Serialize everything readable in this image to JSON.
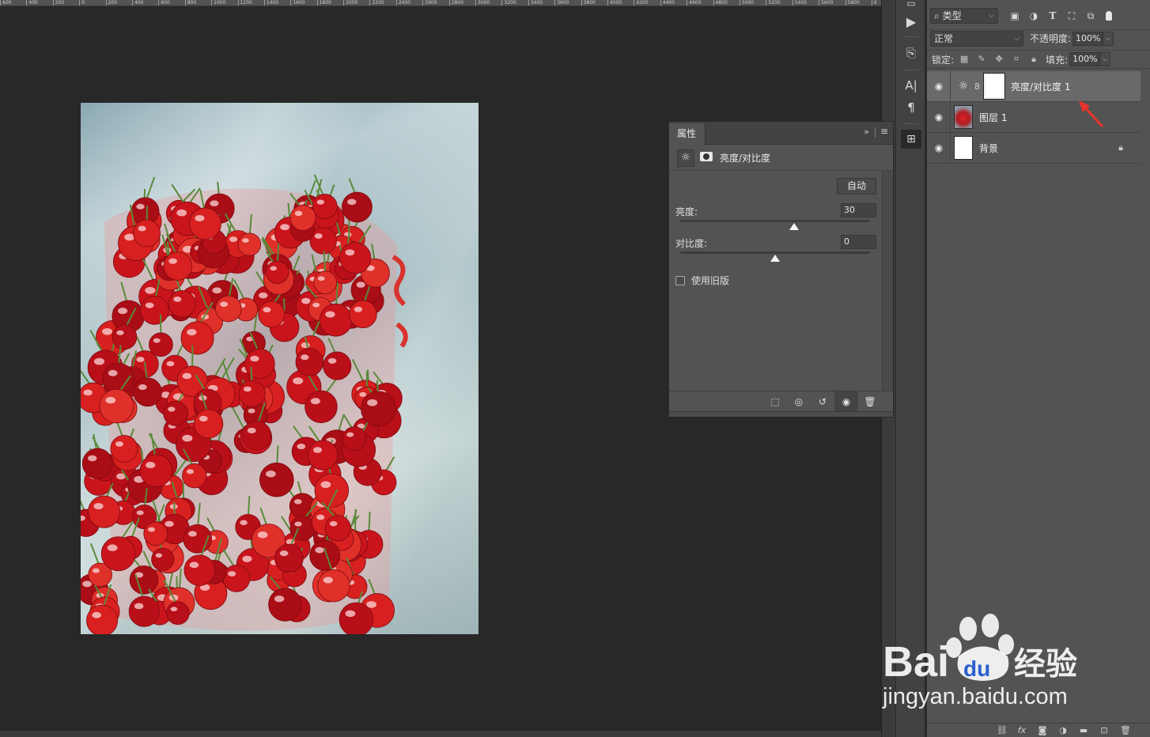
{
  "ruler": {
    "ticks": [
      "600",
      "400",
      "200",
      "0",
      "200",
      "400",
      "600",
      "800",
      "1000",
      "1200",
      "1400",
      "1600",
      "1800",
      "2000",
      "2200",
      "2400",
      "2600",
      "2800",
      "3000",
      "3200",
      "3400",
      "3600",
      "3800",
      "4000",
      "4200",
      "4400",
      "4600",
      "4800",
      "5000",
      "5200",
      "5400",
      "5600",
      "5800",
      "6"
    ]
  },
  "dock": {
    "items": [
      "history-icon",
      "play-icon",
      "brush-settings-icon",
      "character-icon",
      "paragraph-icon",
      "3d-icon"
    ]
  },
  "layers_panel": {
    "filter": {
      "kind_label": "类型",
      "icons": [
        "image-filter-icon",
        "adjustment-filter-icon",
        "type-filter-icon",
        "shape-filter-icon",
        "smart-object-filter-icon"
      ]
    },
    "blend_mode": "正常",
    "opacity_label": "不透明度:",
    "opacity_value": "100%",
    "lock_label": "锁定:",
    "fill_label": "填充:",
    "fill_value": "100%",
    "layers": [
      {
        "name": "亮度/对比度 1",
        "type": "adjustment",
        "selected": true,
        "visible": true
      },
      {
        "name": "图层 1",
        "type": "image",
        "selected": false,
        "visible": true
      },
      {
        "name": "背景",
        "type": "background",
        "selected": false,
        "visible": true,
        "locked": true
      }
    ],
    "bottom_icons": [
      "link-icon",
      "fx-icon",
      "mask-icon",
      "adjustment-icon",
      "folder-icon",
      "new-layer-icon",
      "trash-icon"
    ]
  },
  "properties_panel": {
    "tab_label": "属性",
    "title": "亮度/对比度",
    "auto_label": "自动",
    "brightness_label": "亮度:",
    "brightness_value": "30",
    "brightness_fraction": 0.6,
    "contrast_label": "对比度:",
    "contrast_value": "0",
    "contrast_fraction": 0.5,
    "legacy_label": "使用旧版",
    "legacy_checked": false
  },
  "watermark": {
    "brand": "Bai",
    "brand_tail": "经验",
    "url": "jingyan.baidu.com"
  },
  "colors": {
    "panel_bg": "#535353",
    "canvas_bg": "#282828",
    "selected_layer": "#696969",
    "arrow": "#e8342c"
  }
}
